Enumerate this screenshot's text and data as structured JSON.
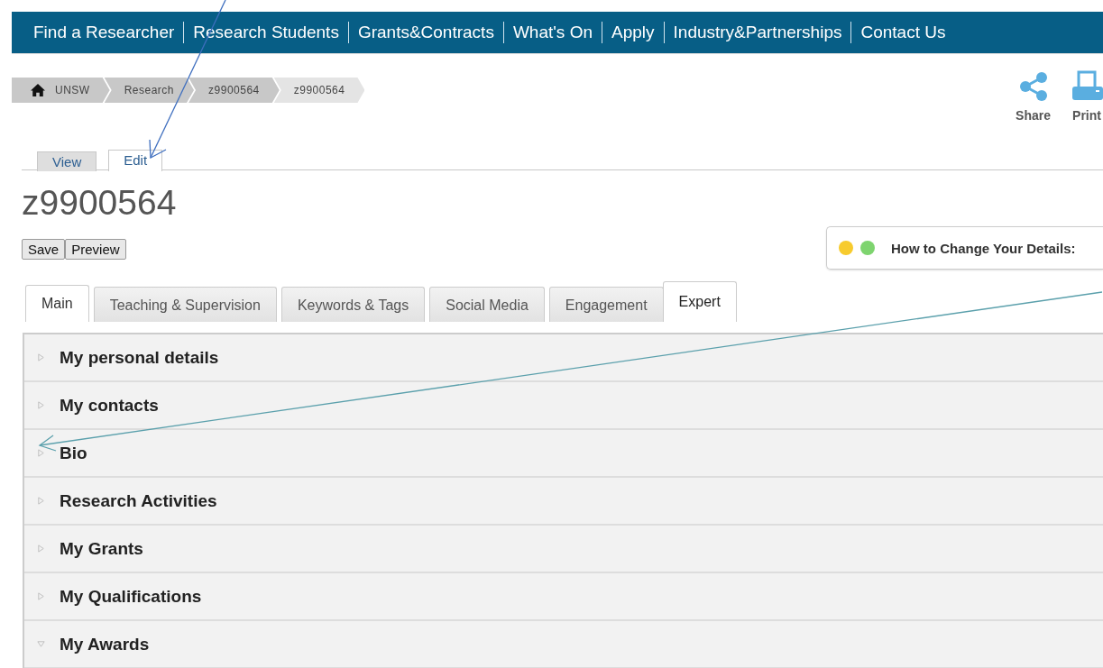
{
  "nav": [
    {
      "label": "Find a Researcher"
    },
    {
      "label": "Research Students"
    },
    {
      "label": "Grants&Contracts"
    },
    {
      "label": "What's On"
    },
    {
      "label": "Apply"
    },
    {
      "label": "Industry&Partnerships"
    },
    {
      "label": "Contact Us"
    }
  ],
  "breadcrumb": [
    {
      "label": "UNSW",
      "home": true,
      "current": false
    },
    {
      "label": "Research",
      "home": false,
      "current": false
    },
    {
      "label": "z9900564",
      "home": false,
      "current": false
    },
    {
      "label": "z9900564",
      "home": false,
      "current": true
    }
  ],
  "actions": [
    {
      "kind": "share",
      "label": "Share"
    },
    {
      "kind": "print",
      "label": "Print"
    }
  ],
  "mode_tabs": [
    {
      "label": "View",
      "selected": false
    },
    {
      "label": "Edit",
      "selected": true
    }
  ],
  "title": "z9900564",
  "buttons": [
    "Save",
    "Preview"
  ],
  "help_box": {
    "dots": [
      {
        "color": "#f7cb2e"
      },
      {
        "color": "#7ed46f"
      }
    ],
    "text": "How to Change Your Details:"
  },
  "tabs": [
    {
      "label": "Main",
      "selected": true,
      "hovered": false
    },
    {
      "label": "Teaching & Supervision",
      "selected": false,
      "hovered": false
    },
    {
      "label": "Keywords & Tags",
      "selected": false,
      "hovered": false
    },
    {
      "label": "Social Media",
      "selected": false,
      "hovered": false
    },
    {
      "label": "Engagement",
      "selected": false,
      "hovered": false
    },
    {
      "label": "Expert",
      "selected": false,
      "hovered": true
    }
  ],
  "sections": [
    {
      "label": "My personal details",
      "expanded": false
    },
    {
      "label": "My contacts",
      "expanded": false
    },
    {
      "label": "Bio",
      "expanded": false
    },
    {
      "label": "Research Activities",
      "expanded": false
    },
    {
      "label": "My Grants",
      "expanded": false
    },
    {
      "label": "My Qualifications",
      "expanded": false
    },
    {
      "label": "My Awards",
      "expanded": true
    }
  ]
}
